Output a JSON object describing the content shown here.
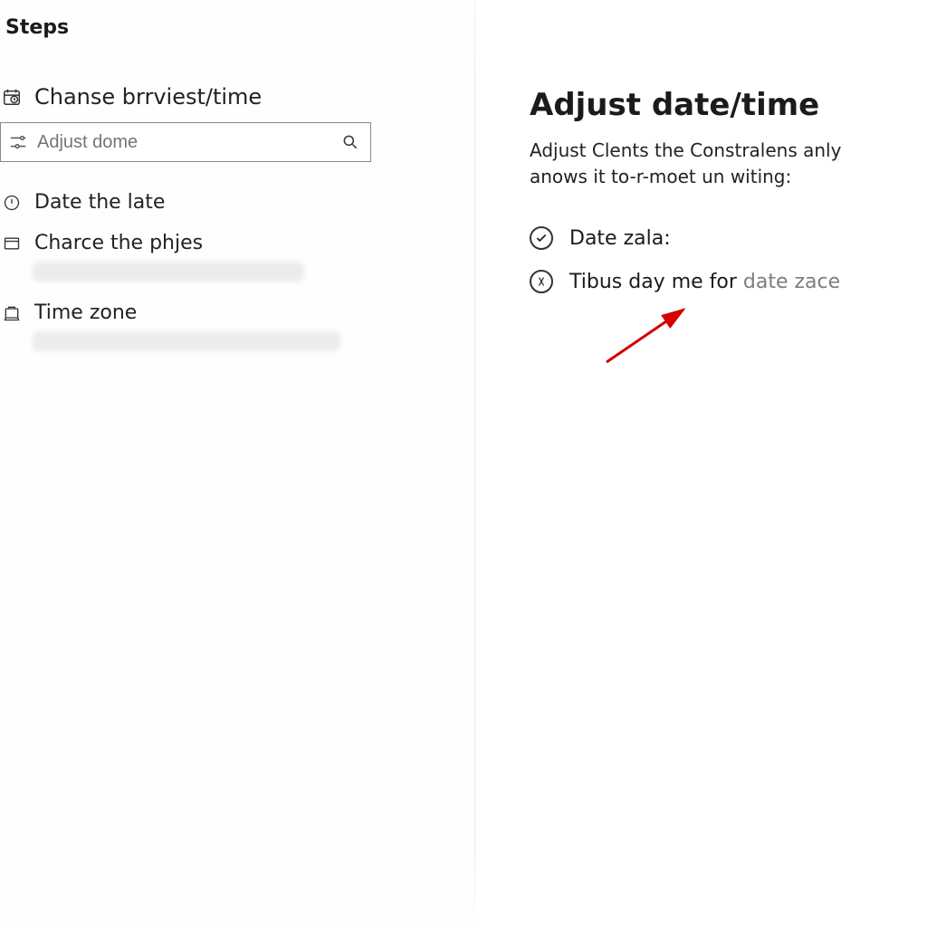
{
  "left": {
    "title": "Steps",
    "heading": "Chanse brrviest/time",
    "search_placeholder": "Adjust dome",
    "items": [
      {
        "label": "Date the late"
      },
      {
        "label": "Charce the phjes"
      },
      {
        "label": "Time zone"
      }
    ]
  },
  "right": {
    "title": "Adjust date/time",
    "description": "Adjust Clents the Constralens anly anows it to-r-moet un witing:",
    "options": [
      {
        "label": "Date zala:"
      },
      {
        "label_main": "Tibus day me for ",
        "label_tail": "date zace"
      }
    ]
  }
}
